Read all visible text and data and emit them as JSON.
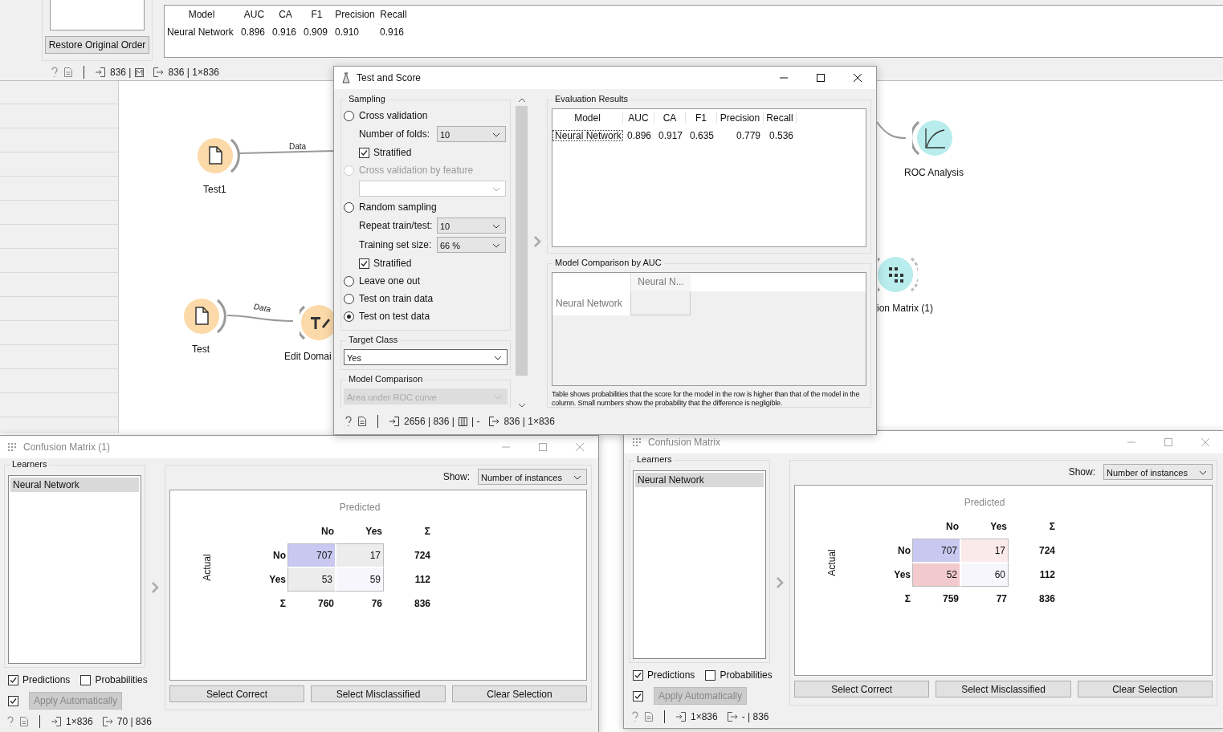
{
  "top_window": {
    "restore_button": "Restore Original Order",
    "table": {
      "columns": [
        "Model",
        "AUC",
        "CA",
        "F1",
        "Precision",
        "Recall"
      ],
      "rows": [
        [
          "Neural Network",
          "0.896",
          "0.916",
          "0.909",
          "0.910",
          "0.916"
        ]
      ]
    },
    "status": {
      "input": "836 |",
      "output": "836 | 1×836"
    }
  },
  "canvas": {
    "nodes": [
      {
        "label": "Test1",
        "kind": "file"
      },
      {
        "label": "Test",
        "kind": "file"
      },
      {
        "label": "Edit Domai",
        "kind": "edit"
      },
      {
        "label": "ROC Analysis",
        "kind": "roc"
      },
      {
        "label": "ion Matrix (1)",
        "kind": "matrix"
      }
    ],
    "links": [
      {
        "label": "Data"
      },
      {
        "label": "Data"
      }
    ]
  },
  "test_and_score": {
    "title": "Test and Score",
    "sampling": {
      "title": "Sampling",
      "items": [
        {
          "kind": "radio",
          "label": "Cross validation",
          "selected": false,
          "disabled": false
        },
        {
          "kind": "combo",
          "label": "Number of folds:",
          "value": "10",
          "disabled": false
        },
        {
          "kind": "check",
          "label": "Stratified",
          "checked": true
        },
        {
          "kind": "radio",
          "label": "Cross validation by feature",
          "selected": false,
          "disabled": true
        },
        {
          "kind": "combo",
          "disabled": false
        },
        {
          "kind": "radio",
          "label": "Random sampling",
          "selected": false,
          "disabled": false
        },
        {
          "kind": "combo",
          "label": "Repeat train/test:",
          "value": "10",
          "disabled": false
        },
        {
          "kind": "combo",
          "label": "Training set size:",
          "value": "66 %",
          "disabled": false
        },
        {
          "kind": "check",
          "label": "Stratified",
          "checked": true
        },
        {
          "kind": "radio",
          "label": "Leave one out",
          "selected": false,
          "disabled": false
        },
        {
          "kind": "radio",
          "label": "Test on train data",
          "selected": false,
          "disabled": false
        },
        {
          "kind": "radio",
          "label": "Test on test data",
          "selected": true,
          "disabled": false
        }
      ]
    },
    "target_class": {
      "title": "Target Class",
      "value": "Yes"
    },
    "model_comparison": {
      "title": "Model Comparison",
      "value": "Area under ROC curve",
      "disabled": true
    },
    "evaluation": {
      "title": "Evaluation Results",
      "columns": [
        "Model",
        "AUC",
        "CA",
        "F1",
        "Precision",
        "Recall"
      ],
      "rows": [
        [
          "Neural Network",
          "0.896",
          "0.917",
          "0.635",
          "0.779",
          "0.536"
        ]
      ]
    },
    "comparison": {
      "title": "Model Comparison by AUC",
      "column_headers": [
        "Neural N..."
      ],
      "row_headers": [
        "Neural Network"
      ],
      "note": "Table shows probabilities that the score for the model in the row is higher than that of the model in the column. Small numbers show the probability that the difference is negligible."
    },
    "status": {
      "input": "2656 | 836 |",
      "input_tail": "| -",
      "output": "836 | 1×836"
    }
  },
  "confusion_windows": [
    {
      "title": "Confusion Matrix (1)",
      "learners_title": "Learners",
      "learners": [
        {
          "label": "Neural Network",
          "selected": true
        }
      ],
      "show_label": "Show:",
      "show_value": "Number of instances",
      "predicted": "Predicted",
      "actual": "Actual",
      "columns": [
        "No",
        "Yes",
        "Σ"
      ],
      "rows": [
        {
          "label": "No",
          "cells": [
            {
              "value": "707",
              "color": "#c8c8f0"
            },
            {
              "value": "17",
              "color": "#ececec"
            }
          ],
          "total": "724"
        },
        {
          "label": "Yes",
          "cells": [
            {
              "value": "53",
              "color": "#ececec"
            },
            {
              "value": "59",
              "color": "#f6f6fc"
            }
          ],
          "total": "112"
        }
      ],
      "totals": {
        "label": "Σ",
        "values": [
          "760",
          "76"
        ],
        "total": "836"
      },
      "predictions": {
        "label": "Predictions",
        "checked": true
      },
      "probabilities": {
        "label": "Probabilities",
        "checked": false
      },
      "auto_apply_checked": true,
      "apply_button": "Apply Automatically",
      "buttons": [
        "Select Correct",
        "Select Misclassified",
        "Clear Selection"
      ],
      "status": {
        "input": "1×836",
        "output": "70 | 836"
      }
    },
    {
      "title": "Confusion Matrix",
      "learners_title": "Learners",
      "learners": [
        {
          "label": "Neural Network",
          "selected": true
        }
      ],
      "show_label": "Show:",
      "show_value": "Number of instances",
      "predicted": "Predicted",
      "actual": "Actual",
      "columns": [
        "No",
        "Yes",
        "Σ"
      ],
      "rows": [
        {
          "label": "No",
          "cells": [
            {
              "value": "707",
              "color": "#c8c8f0"
            },
            {
              "value": "17",
              "color": "#fbeaea"
            }
          ],
          "total": "724"
        },
        {
          "label": "Yes",
          "cells": [
            {
              "value": "52",
              "color": "#f2c9cc"
            },
            {
              "value": "60",
              "color": "#f6f6fc"
            }
          ],
          "total": "112"
        }
      ],
      "totals": {
        "label": "Σ",
        "values": [
          "759",
          "77"
        ],
        "total": "836"
      },
      "predictions": {
        "label": "Predictions",
        "checked": true
      },
      "probabilities": {
        "label": "Probabilities",
        "checked": false
      },
      "auto_apply_checked": true,
      "apply_button": "Apply Automatically",
      "buttons": [
        "Select Correct",
        "Select Misclassified",
        "Clear Selection"
      ],
      "status": {
        "input": "1×836",
        "output": "- | 836"
      }
    }
  ]
}
